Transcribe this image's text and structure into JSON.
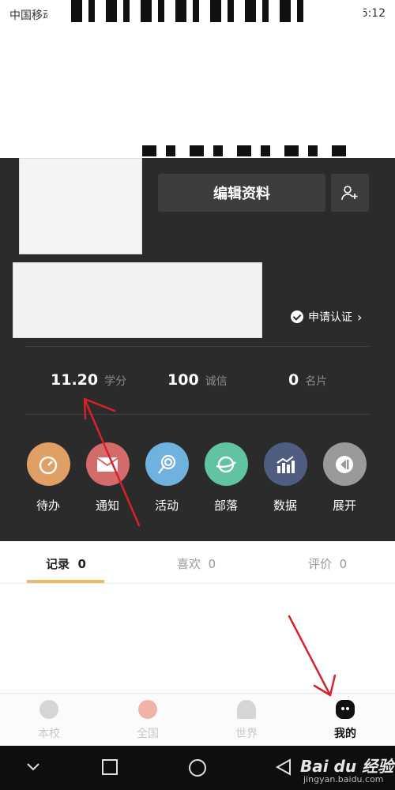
{
  "status_bar": {
    "carrier": "中国移动",
    "time": "16:12"
  },
  "profile": {
    "edit_label": "编辑资料",
    "verify_label": "申请认证"
  },
  "stats": [
    {
      "value": "11.20",
      "label": "学分"
    },
    {
      "value": "100",
      "label": "诚信"
    },
    {
      "value": "0",
      "label": "名片"
    }
  ],
  "shortcuts": [
    {
      "label": "待办",
      "color": "#e0a065",
      "icon": "timer-icon"
    },
    {
      "label": "通知",
      "color": "#d36b6b",
      "icon": "mail-icon"
    },
    {
      "label": "活动",
      "color": "#6fb1df",
      "icon": "lollipop-icon"
    },
    {
      "label": "部落",
      "color": "#62c2a4",
      "icon": "planet-icon"
    },
    {
      "label": "数据",
      "color": "#4f5d80",
      "icon": "chart-icon"
    },
    {
      "label": "展开",
      "color": "#9a9a9a",
      "icon": "expand-icon"
    }
  ],
  "tabs": [
    {
      "label": "记录",
      "count": "0",
      "active": true
    },
    {
      "label": "喜欢",
      "count": "0",
      "active": false
    },
    {
      "label": "评价",
      "count": "0",
      "active": false
    }
  ],
  "bottom_nav": [
    {
      "label": "本校",
      "active": false
    },
    {
      "label": "全国",
      "active": false
    },
    {
      "label": "世界",
      "active": false
    },
    {
      "label": "我的",
      "active": true
    }
  ],
  "watermark": {
    "brand": "Bai du 经验",
    "url": "jingyan.baidu.com"
  },
  "colors": {
    "panel": "#2b2b2b",
    "accent": "#e8bb6a",
    "annotation": "#d6222a"
  }
}
